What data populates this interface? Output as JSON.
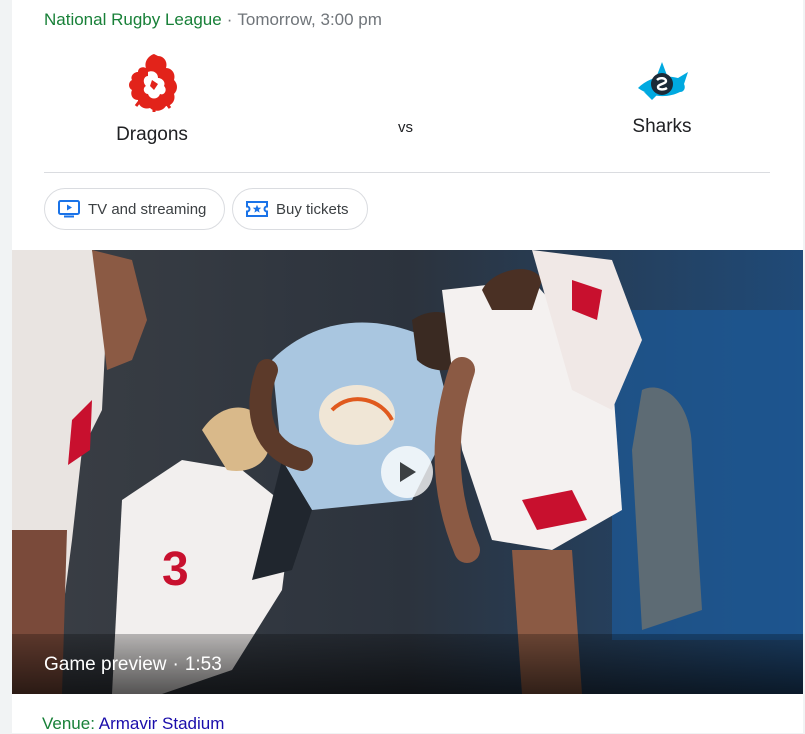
{
  "match": {
    "league": "National Rugby League",
    "separator": "·",
    "time": "Tomorrow, 3:00 pm",
    "vs_label": "vs",
    "home_team": {
      "name": "Dragons",
      "logo_icon": "dragons-logo-icon",
      "color": "#e2231a"
    },
    "away_team": {
      "name": "Sharks",
      "logo_icon": "sharks-logo-icon",
      "color": "#00a9e0"
    }
  },
  "actions": {
    "tv_label": "TV and streaming",
    "tickets_label": "Buy tickets"
  },
  "video": {
    "title": "Game preview",
    "separator": "·",
    "duration": "1:53"
  },
  "venue": {
    "label": "Venue:",
    "name": "Armavir Stadium"
  },
  "colors": {
    "league_green": "#188038",
    "link_blue": "#1a0dab",
    "icon_blue": "#1a73e8"
  }
}
